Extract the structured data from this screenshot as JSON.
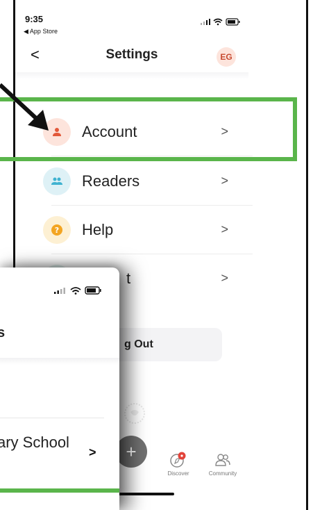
{
  "status_bar": {
    "time": "9:35",
    "back_app": "◀ App Store"
  },
  "header": {
    "back": "<",
    "title": "Settings",
    "avatar_initials": "EG"
  },
  "menu": {
    "items": [
      {
        "label": "Account",
        "chevron": ">",
        "icon": "person-icon",
        "icon_bg": "#fde4dc",
        "icon_color": "#e2583a"
      },
      {
        "label": "Readers",
        "chevron": ">",
        "icon": "group-icon",
        "icon_bg": "#def1f6",
        "icon_color": "#3fb2d0"
      },
      {
        "label": "Help",
        "chevron": ">",
        "icon": "question-icon",
        "icon_bg": "#fdf0d3",
        "icon_color": "#f3a522"
      },
      {
        "label": "t",
        "chevron": ">",
        "icon": "info-icon",
        "icon_bg": "#e1f0ec",
        "icon_color": "#5aa891"
      }
    ]
  },
  "logout": {
    "label": "g Out"
  },
  "tabbar": {
    "items": [
      {
        "label": "Discover",
        "icon": "compass-icon"
      },
      {
        "label": "Community",
        "icon": "community-icon"
      }
    ],
    "plus": "+"
  },
  "overlay": {
    "title_fragment": "s",
    "school_label": "ary School",
    "chevron": ">"
  },
  "colors": {
    "highlight": "#5ab54b",
    "accent_red": "#e2583a"
  }
}
